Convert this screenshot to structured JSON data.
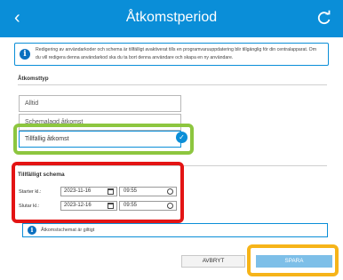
{
  "header": {
    "back_icon": "chevron-left-icon",
    "title": "Åtkomstperiod",
    "refresh_icon": "refresh-icon",
    "background_color": "#0a8ed8"
  },
  "info": {
    "icon": "info-icon",
    "text": "Redigering av användarkoder och schema är tillfälligt avaktiverat tills en programvaruuppdatering blir tillgänglig för din centralapparat. Om du vill redigera denna användarkod ska du ta bort denna användare och skapa en ny användare."
  },
  "access_type": {
    "label": "Åtkomsttyp",
    "options": [
      {
        "label": "Alltid",
        "selected": false
      },
      {
        "label": "Schemalagd åtkomst",
        "selected": false
      },
      {
        "label": "Tillfällig åtkomst",
        "selected": true
      }
    ]
  },
  "schedule": {
    "title": "Tillfälligt schema",
    "start_label": "Starter kl.:",
    "start_date": "2023-11-16",
    "start_time": "09:55",
    "end_label": "Slutar kl.:",
    "end_date": "2023-12-16",
    "end_time": "09:55"
  },
  "status": {
    "icon": "info-icon",
    "text": "Åtkomstschemat är giltigt"
  },
  "buttons": {
    "cancel": "AVBRYT",
    "save": "SPARA"
  },
  "highlight_colors": {
    "selected_option": "#8dc63f",
    "schedule": "#e31414",
    "save_button": "#f6b419"
  }
}
